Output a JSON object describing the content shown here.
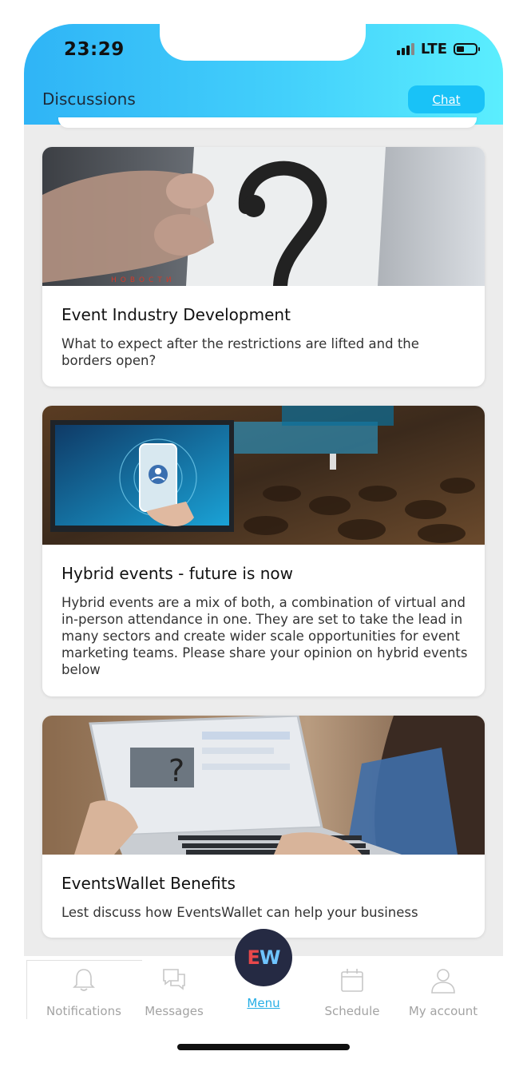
{
  "status_bar": {
    "time": "23:29",
    "network": "LTE"
  },
  "header": {
    "title": "Discussions",
    "chat_label": "Chat"
  },
  "cards": [
    {
      "title": "Event Industry Development",
      "description": "What to expect after the restrictions are lifted and the borders open?",
      "image_caption": "НОВОСТИ"
    },
    {
      "title": "Hybrid events - future is now",
      "description": "Hybrid events are a mix of both, a combination of virtual and in-person attendance in one. They are set to take the lead in many sectors and create wider scale opportunities for event marketing teams. Please share your opinion on hybrid events below"
    },
    {
      "title": "EventsWallet Benefits",
      "description": "Lest discuss how EventsWallet can help your business"
    }
  ],
  "tab_bar": {
    "notifications": "Notifications",
    "messages": "Messages",
    "menu": "Menu",
    "menu_logo": "EW",
    "schedule": "Schedule",
    "account": "My account"
  },
  "colors": {
    "header_start": "#2fb4f6",
    "header_end": "#5beefe",
    "chat_button": "#19c2f7",
    "menu_circle": "#252a43",
    "active_tab": "#26aee6",
    "inactive_tab": "#a3a3a3"
  },
  "icons": [
    "bell-icon",
    "chat-bubbles-icon",
    "calendar-icon",
    "person-icon",
    "signal-icon",
    "battery-icon"
  ]
}
